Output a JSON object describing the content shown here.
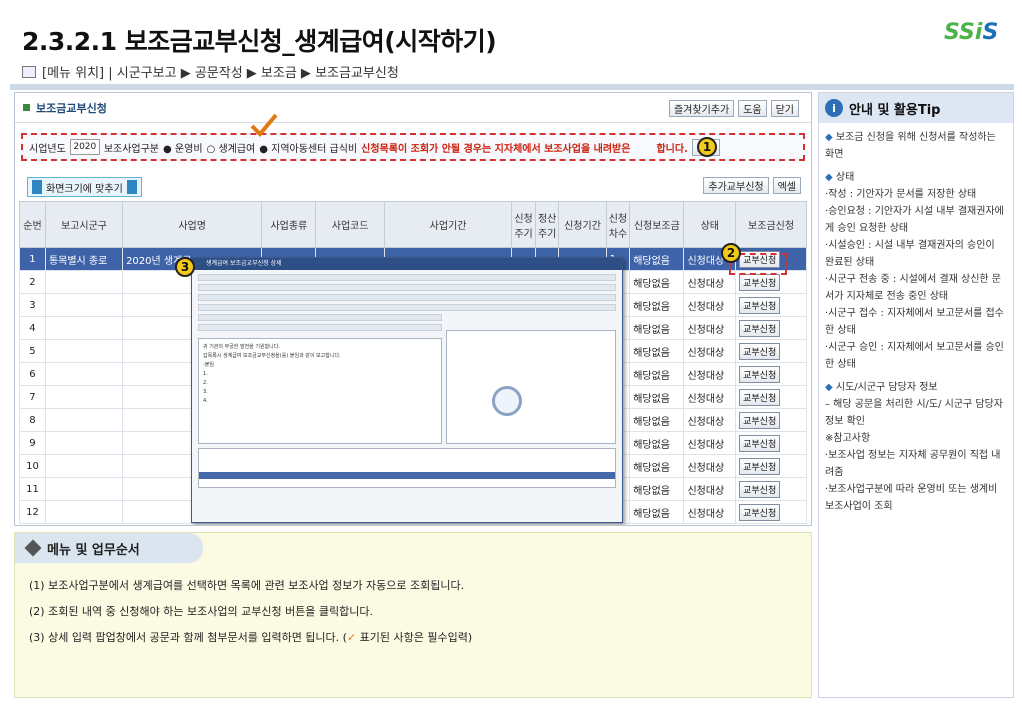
{
  "title": "2.3.2.1 보조금교부신청_생계급여(시작하기)",
  "logo": {
    "main": "SSi",
    "accent": "S"
  },
  "location": "[메뉴 위치] | 시군구보고 ▶ 공문작성 ▶ 보조금 ▶ 보조금교부신청",
  "screen": {
    "panel_title": "보조금교부신청",
    "header_buttons": [
      "즐겨찾기추가",
      "도움",
      "닫기"
    ],
    "filter": {
      "year_label": "시업년도",
      "year_value": "2020",
      "type_label": "보조사업구분",
      "opt1": "운영비",
      "opt2": "생계급여",
      "opt3": "지역아동센터 급식비",
      "warning": "신청목록이 조회가 안될 경우는 지자체에서 보조사업을 내려받은",
      "warning_tail": "합니다.",
      "search": "조회"
    },
    "fit_label": "화면크기에 맞추기",
    "tool_buttons": [
      "추가교부신청",
      "엑셀"
    ],
    "columns": [
      "순번",
      "보고시군구",
      "사업명",
      "사업종류",
      "사업코드",
      "사업기간",
      "신청주기",
      "정산주기",
      "신청기간",
      "신청차수",
      "신청보조금",
      "상태",
      "보조금신청"
    ],
    "first_row": {
      "no": "1",
      "region": "통목별시 종로",
      "project": "2020년 생계급"
    },
    "rows": [
      "2",
      "3",
      "4",
      "5",
      "6",
      "7",
      "8",
      "9",
      "10",
      "11",
      "12"
    ],
    "row_values": {
      "turn": "1",
      "amount": "해당없음",
      "status": "신청대상",
      "action": "교부신청"
    }
  },
  "popup": {
    "title": "생계급여 보조금교부신청 상세",
    "lines": [
      "귀 기관의 무궁한 발전을 기원합니다.",
      "갑목록시 생계급여 보조금교부신청을(를) 붙임과 같이 보고합니다.",
      "-붙임",
      "1.",
      "2.",
      "3.",
      "4."
    ]
  },
  "tips": {
    "header": "안내 및 활용Tip",
    "items": [
      "보조금 신청을 위해 신청서를 작성하는 화면",
      "상태",
      "·작성 : 기안자가 문서를 저장한 상태",
      "·승인요청 : 기안자가 시설 내부 결재권자에게 승인 요청한 상태",
      "·시설승인 : 시설 내부 결재권자의 승인이 완료된 상태",
      "·시군구 전송 중 : 시설에서 결재 상신한 문서가 지자체로 전송 중인 상태",
      "·시군구 접수 : 지자체에서 보고문서를 접수한 상태",
      "·시군구 승인 : 지자체에서 보고문서를 승인한 상태",
      "시도/시군구 담당자 정보",
      "– 해당 공문을 처리한 시/도/ 시군구 담당자 정보 확인",
      "※참고사항",
      "·보조사업 정보는 지자체 공무원이 직접 내려줌",
      "·보조사업구분에 따라 운영비 또는 생계비 보조사업이 조회"
    ]
  },
  "menu": {
    "header": "메뉴 및 업무순서",
    "l1": "(1) 보조사업구분에서 생계급여를 선택하면 목록에 관련 보조사업 정보가 자동으로 조회됩니다.",
    "l2": "(2) 조회된 내역 중 신청해야 하는 보조사업의 교부신청 버튼을 클릭합니다.",
    "l3a": "(3) 상세 입력 팝업창에서 공문과 함께 첨부문서를 입력하면 됩니다. (",
    "l3c": " 표기된 사항은 필수입력)"
  },
  "badges": [
    "1",
    "2",
    "3"
  ]
}
